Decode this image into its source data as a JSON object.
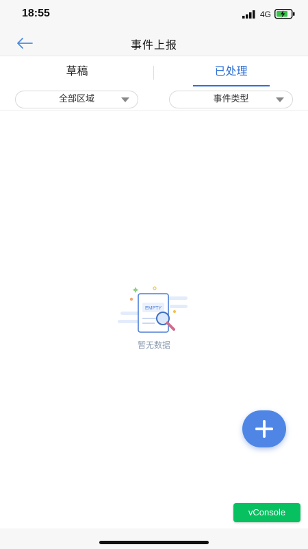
{
  "status_bar": {
    "time": "18:55",
    "network": "4G",
    "signal_icon": "signal-bars-icon",
    "battery_icon": "battery-charging-icon"
  },
  "nav": {
    "title": "事件上报",
    "back_icon": "arrow-left-icon"
  },
  "tabs": [
    {
      "label": "草稿",
      "active": false
    },
    {
      "label": "已处理",
      "active": true
    }
  ],
  "filters": {
    "area": "全部区域",
    "type": "事件类型"
  },
  "empty_state": {
    "badge": "EMPTY",
    "message": "暂无数据"
  },
  "fab": {
    "icon": "plus-icon"
  },
  "vconsole": {
    "label": "vConsole"
  },
  "colors": {
    "accent": "#2f6fd8",
    "fab": "#4f86e6",
    "vconsole": "#07c160",
    "empty_text": "#8a9bb0"
  }
}
